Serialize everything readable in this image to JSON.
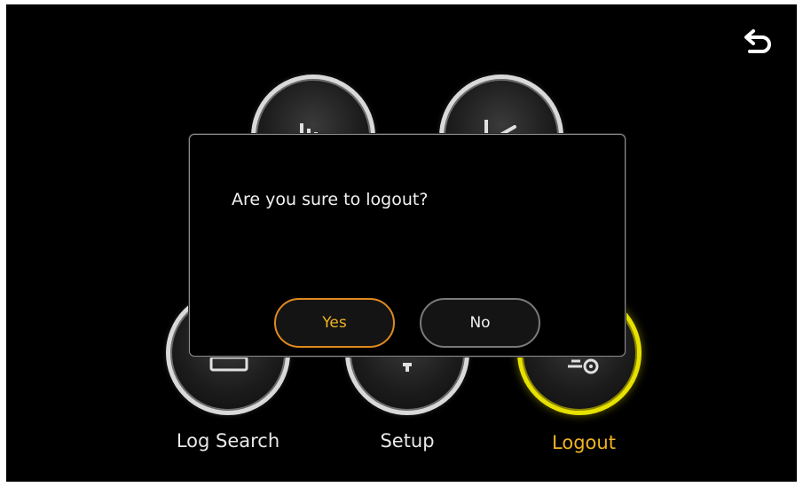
{
  "header": {
    "back_icon": "return-arrow-icon"
  },
  "menu": {
    "items": [
      {
        "label": "",
        "icon": "bar-chart-icon"
      },
      {
        "label": "",
        "icon": "line-trend-icon"
      },
      {
        "label": "Log Search",
        "icon": "log-search-icon"
      },
      {
        "label": "Setup",
        "icon": "setup-gear-icon"
      },
      {
        "label": "Logout",
        "icon": "logout-icon",
        "active": true
      }
    ]
  },
  "dialog": {
    "message": "Are you sure to logout?",
    "yes_label": "Yes",
    "no_label": "No"
  },
  "colors": {
    "background": "#000000",
    "accent_yellow": "#e6e100",
    "accent_orange": "#f0b324",
    "text": "#e8e8e8",
    "ring": "#d9d9d9"
  }
}
